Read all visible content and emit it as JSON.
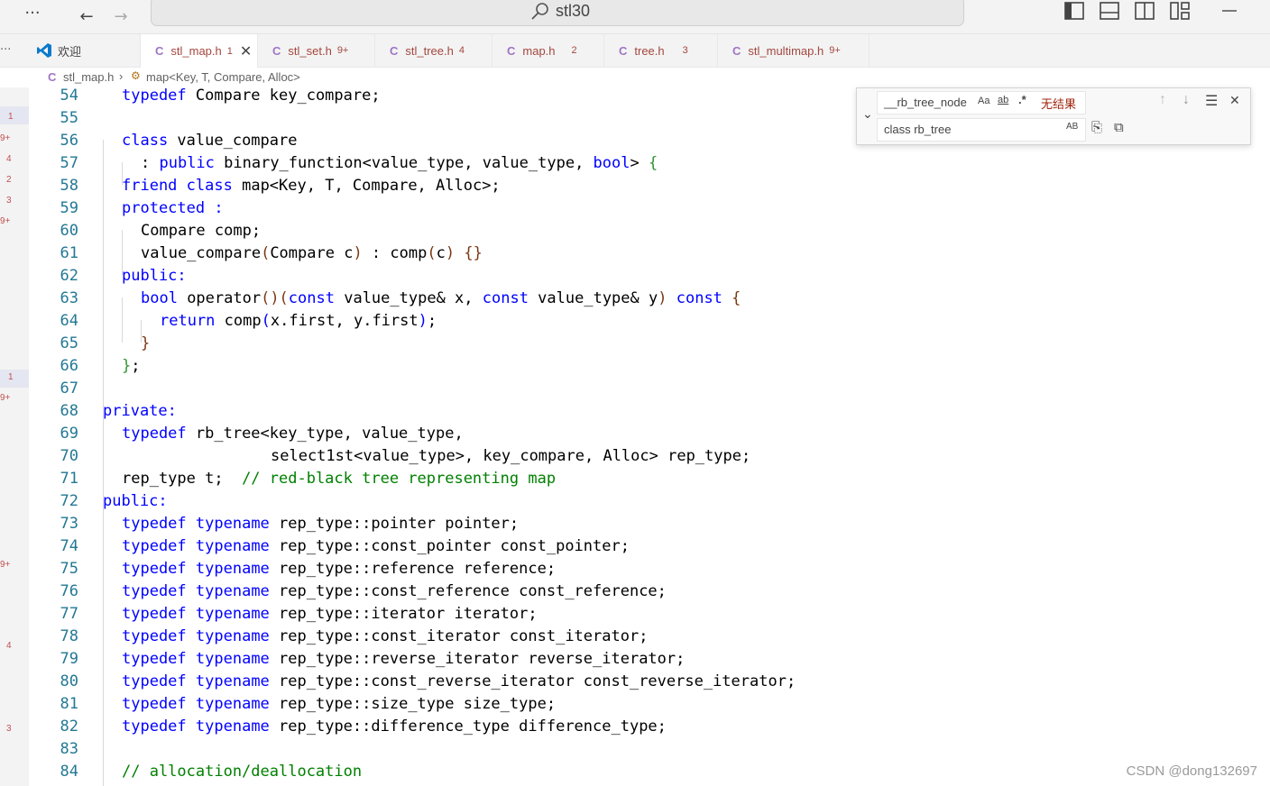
{
  "titlebar": {
    "search_text": "stl30",
    "more": "···",
    "back": "←",
    "forward": "→"
  },
  "tabs": [
    {
      "label": "欢迎",
      "badge": "",
      "active": false
    },
    {
      "label": "stl_map.h",
      "badge": "1",
      "active": true
    },
    {
      "label": "stl_set.h",
      "badge": "9+",
      "active": false
    },
    {
      "label": "stl_tree.h",
      "badge": "4",
      "active": false
    },
    {
      "label": "map.h",
      "badge": "2",
      "active": false
    },
    {
      "label": "tree.h",
      "badge": "3",
      "active": false
    },
    {
      "label": "stl_multimap.h",
      "badge": "9+",
      "active": false
    }
  ],
  "breadcrumb": {
    "file": "stl_map.h",
    "symbol": "map<Key, T, Compare, Alloc>"
  },
  "find_widget": {
    "find_value": "__rb_tree_node",
    "opt_case": "Aa",
    "opt_word": "ab",
    "opt_regex": ".*",
    "result": "无结果",
    "replace_value": "class rb_tree",
    "opt_preserve": "AB"
  },
  "gutter_marks": [
    "1",
    "9+",
    "4",
    "2",
    "3",
    "9+",
    "1",
    "9+",
    "9+",
    "4",
    "3"
  ],
  "line_numbers": [
    "54",
    "55",
    "56",
    "57",
    "58",
    "59",
    "60",
    "61",
    "62",
    "63",
    "64",
    "65",
    "66",
    "67",
    "68",
    "69",
    "70",
    "71",
    "72",
    "73",
    "74",
    "75",
    "76",
    "77",
    "78",
    "79",
    "80",
    "81",
    "82",
    "83",
    "84"
  ],
  "code": {
    "l54": "typedef Compare key_compare;",
    "l56": "class value_compare",
    "l57": ": public binary_function<value_type, value_type, bool> {",
    "l58": "friend class map<Key, T, Compare, Alloc>;",
    "l59": "protected :",
    "l60": "Compare comp;",
    "l61": "value_compare(Compare c) : comp(c) {}",
    "l62": "public:",
    "l63": "bool operator()(const value_type& x, const value_type& y) const {",
    "l64": "return comp(x.first, y.first);",
    "l65": "}",
    "l66": "};",
    "l68": "private:",
    "l69": "typedef rb_tree<key_type, value_type,",
    "l70": "select1st<value_type>, key_compare, Alloc> rep_type;",
    "l71a": "rep_type t;",
    "l71b": "// red-black tree representing map",
    "l72": "public:",
    "l73": "rep_type::pointer pointer;",
    "l74": "rep_type::const_pointer const_pointer;",
    "l75": "rep_type::reference reference;",
    "l76": "rep_type::const_reference const_reference;",
    "l77": "rep_type::iterator iterator;",
    "l78": "rep_type::const_iterator const_iterator;",
    "l79": "rep_type::reverse_iterator reverse_iterator;",
    "l80": "rep_type::const_reverse_iterator const_reverse_iterator;",
    "l81": "rep_type::size_type size_type;",
    "l82": "rep_type::difference_type difference_type;",
    "l84": "// allocation/deallocation",
    "kw_typedef": "typedef",
    "kw_typename": "typename"
  },
  "watermark": "CSDN @dong132697"
}
